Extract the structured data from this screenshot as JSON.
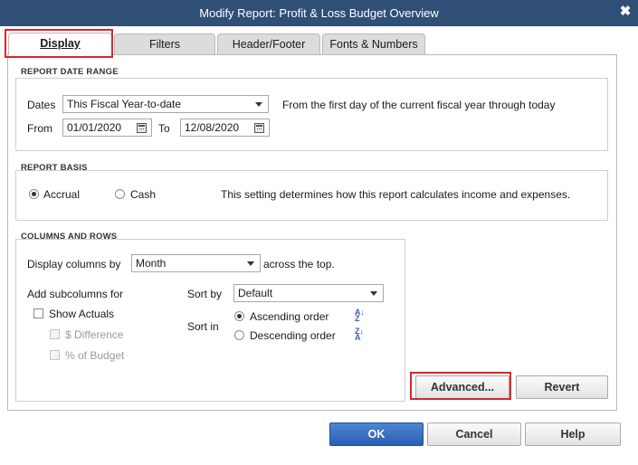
{
  "window": {
    "title": "Modify Report: Profit & Loss Budget Overview",
    "close_glyph": "✖"
  },
  "tabs": [
    {
      "label": "Display",
      "active": true
    },
    {
      "label": "Filters",
      "active": false
    },
    {
      "label": "Header/Footer",
      "active": false
    },
    {
      "label": "Fonts & Numbers",
      "active": false
    }
  ],
  "report_date_range": {
    "section_title": "REPORT DATE RANGE",
    "dates_label": "Dates",
    "dates_value": "This Fiscal Year-to-date",
    "dates_description": "From the first day of the current fiscal year through today",
    "from_label": "From",
    "from_value": "01/01/2020",
    "to_label": "To",
    "to_value": "12/08/2020"
  },
  "report_basis": {
    "section_title": "REPORT BASIS",
    "accrual_label": "Accrual",
    "accrual_selected": true,
    "cash_label": "Cash",
    "cash_selected": false,
    "description": "This setting determines how this report calculates income and expenses."
  },
  "columns_and_rows": {
    "section_title": "COLUMNS AND ROWS",
    "display_columns_label": "Display columns by",
    "display_columns_value": "Month",
    "across_label": "across the top.",
    "add_subcolumns_label": "Add subcolumns for",
    "show_actuals_label": "Show Actuals",
    "show_actuals_checked": false,
    "dollar_difference_label": "$ Difference",
    "percent_budget_label": "% of Budget",
    "sort_by_label": "Sort by",
    "sort_by_value": "Default",
    "sort_in_label": "Sort in",
    "ascending_label": "Ascending order",
    "ascending_selected": true,
    "descending_label": "Descending order",
    "descending_selected": false
  },
  "buttons": {
    "advanced": "Advanced...",
    "revert": "Revert",
    "ok": "OK",
    "cancel": "Cancel",
    "help": "Help"
  },
  "colors": {
    "titlebar": "#2f4f77",
    "highlight": "#d7262e",
    "primary_button": "#2a5fb3"
  }
}
